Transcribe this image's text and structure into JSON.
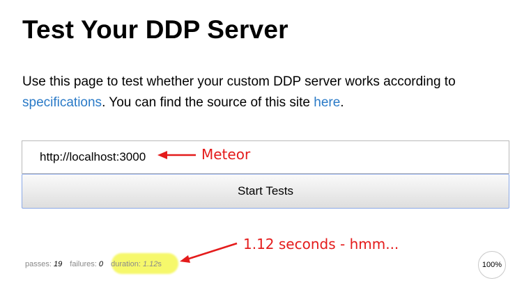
{
  "page": {
    "title": "Test Your DDP Server",
    "intro_text_1": "Use this page to test whether your custom DDP server works according to",
    "intro_link_specifications": "specifications",
    "intro_text_2": ". You can find the source of this site",
    "intro_link_here": "here",
    "intro_text_3": "."
  },
  "form": {
    "server_url_value": "http://localhost:3000",
    "start_button_label": "Start Tests"
  },
  "annotations": {
    "meteor_label": "Meteor",
    "seconds_label": "1.12 seconds - hmm...",
    "color": "#e41b1b",
    "highlight_color": "#f6f86b"
  },
  "stats": {
    "passes_label": "passes:",
    "passes_value": "19",
    "failures_label": "failures:",
    "failures_value": "0",
    "duration_label": "duration:",
    "duration_value": "1.12",
    "duration_unit": "s",
    "progress_text": "100%",
    "progress_value": 1.0
  },
  "colors": {
    "link": "#2a7ac7",
    "button_border": "#8aa8e6"
  }
}
